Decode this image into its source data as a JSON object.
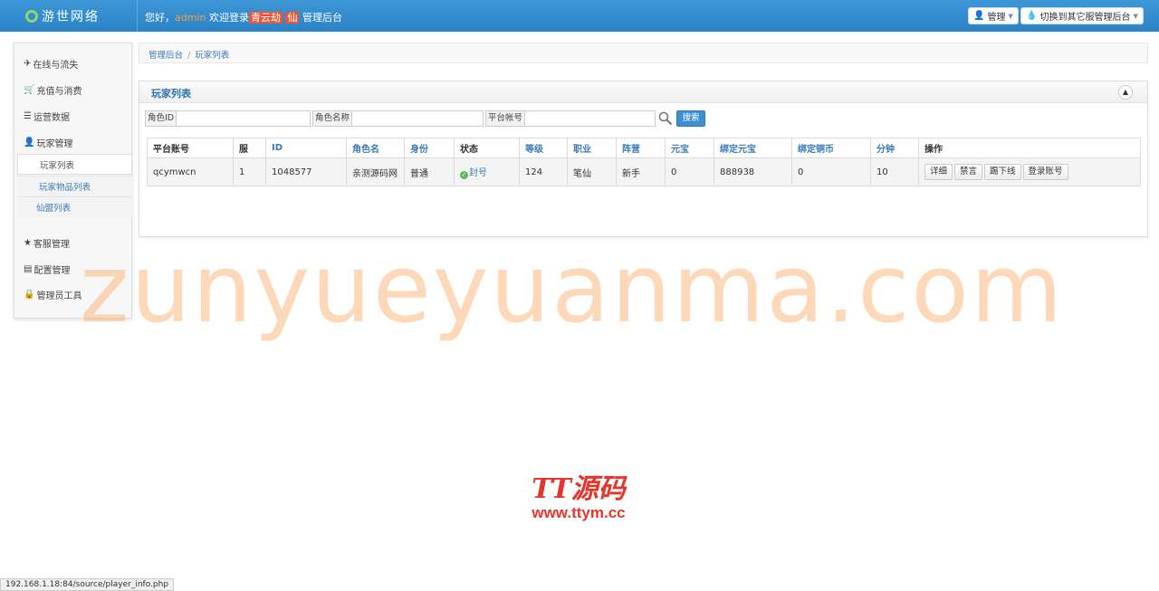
{
  "brand": {
    "name": "游世网络"
  },
  "header": {
    "greeting": "您好，",
    "username": "admin",
    "welcome_text": "欢迎登录",
    "game_name": "青云劫",
    "game_suffix": "仙",
    "admin_label": "管理后台",
    "manage_button": "管理",
    "switch_button": "切换到其它服管理后台"
  },
  "sidebar": {
    "items": [
      {
        "label": "在线与流失",
        "icon": "✈"
      },
      {
        "label": "充值与消费",
        "icon": "🛒"
      },
      {
        "label": "运营数据",
        "icon": "☰"
      },
      {
        "label": "玩家管理",
        "icon": "👤"
      },
      {
        "label": "客服管理",
        "icon": "★"
      },
      {
        "label": "配置管理",
        "icon": "▤"
      },
      {
        "label": "管理员工具",
        "icon": "🔒"
      }
    ],
    "sub_items": [
      "玩家列表",
      "玩家物品列表",
      "仙盟列表"
    ]
  },
  "breadcrumb": {
    "home": "管理后台",
    "current": "玩家列表"
  },
  "panel": {
    "title": "玩家列表",
    "collapse_icon": "chevron-up-icon"
  },
  "filters": {
    "role_id_label": "角色ID",
    "role_name_label": "角色名称",
    "platform_account_label": "平台帐号",
    "search_button": "搜索"
  },
  "table": {
    "headers": [
      "平台账号",
      "服",
      "ID",
      "角色名",
      "身份",
      "状态",
      "等级",
      "职业",
      "阵营",
      "元宝",
      "绑定元宝",
      "绑定铜币",
      "分钟",
      "操作"
    ],
    "rows": [
      {
        "account": "qcymwcn",
        "server": "1",
        "id": "1048577",
        "role_name": "亲测源码网",
        "identity": "普通",
        "status": "封号",
        "level": "124",
        "job": "笔仙",
        "camp": "新手",
        "yuanbao": "0",
        "bound_yuanbao": "888938",
        "bound_copper": "0",
        "minutes": "10",
        "actions": [
          "详细",
          "禁言",
          "踢下线",
          "登录账号"
        ]
      }
    ]
  },
  "watermark": {
    "big_text": "zunyueyuanma.com",
    "logo_text": "TT源码",
    "logo_url": "www.ttym.cc"
  },
  "status_bar": {
    "url": "192.168.1.18:84/source/player_info.php"
  },
  "colors": {
    "topbar": "#2a83c6",
    "link": "#3a7bb5",
    "watermark": "#faaa64",
    "logo": "#e8352c"
  }
}
